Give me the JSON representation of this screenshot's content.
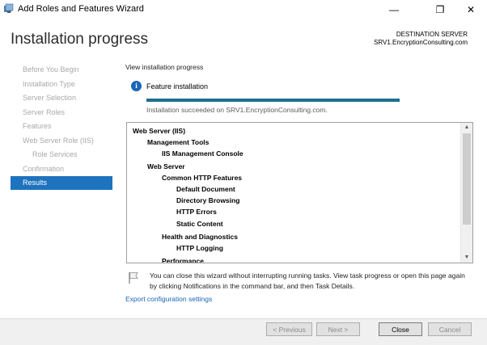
{
  "window": {
    "title": "Add Roles and Features Wizard",
    "minimize_glyph": "—",
    "maximize_glyph": "❐",
    "close_glyph": "✕"
  },
  "header": {
    "page_title": "Installation progress",
    "destination_label": "DESTINATION SERVER",
    "destination_server": "SRV1.EncryptionConsulting.com"
  },
  "nav": {
    "items": [
      {
        "label": "Before You Begin",
        "state": "disabled"
      },
      {
        "label": "Installation Type",
        "state": "disabled"
      },
      {
        "label": "Server Selection",
        "state": "disabled"
      },
      {
        "label": "Server Roles",
        "state": "disabled"
      },
      {
        "label": "Features",
        "state": "disabled"
      },
      {
        "label": "Web Server Role (IIS)",
        "state": "disabled"
      },
      {
        "label": "Role Services",
        "state": "disabled"
      },
      {
        "label": "Confirmation",
        "state": "disabled"
      },
      {
        "label": "Results",
        "state": "active"
      }
    ]
  },
  "main": {
    "view_progress_label": "View installation progress",
    "info_icon_glyph": "i",
    "feature_installation_label": "Feature installation",
    "progress": 1.0,
    "status_text": "Installation succeeded on SRV1.EncryptionConsulting.com.",
    "installed_items": [
      {
        "label": "Web Server (IIS)",
        "level": 0
      },
      {
        "label": "Management Tools",
        "level": 1
      },
      {
        "label": "IIS Management Console",
        "level": 2
      },
      {
        "label": "Web Server",
        "level": 1
      },
      {
        "label": "Common HTTP Features",
        "level": 2
      },
      {
        "label": "Default Document",
        "level": 3
      },
      {
        "label": "Directory Browsing",
        "level": 3
      },
      {
        "label": "HTTP Errors",
        "level": 3
      },
      {
        "label": "Static Content",
        "level": 3
      },
      {
        "label": "Health and Diagnostics",
        "level": 2
      },
      {
        "label": "HTTP Logging",
        "level": 3
      },
      {
        "label": "Performance",
        "level": 2
      }
    ],
    "scroll_up_glyph": "▲",
    "scroll_down_glyph": "▼",
    "notice_text": "You can close this wizard without interrupting running tasks. View task progress or open this page again by clicking Notifications in the command bar, and then Task Details.",
    "export_link": "Export configuration settings"
  },
  "footer": {
    "previous_label": "< Previous",
    "next_label": "Next >",
    "close_label": "Close",
    "cancel_label": "Cancel"
  },
  "colors": {
    "accent": "#1e73be",
    "progress": "#1e6f8f",
    "link": "#1a65b8"
  }
}
